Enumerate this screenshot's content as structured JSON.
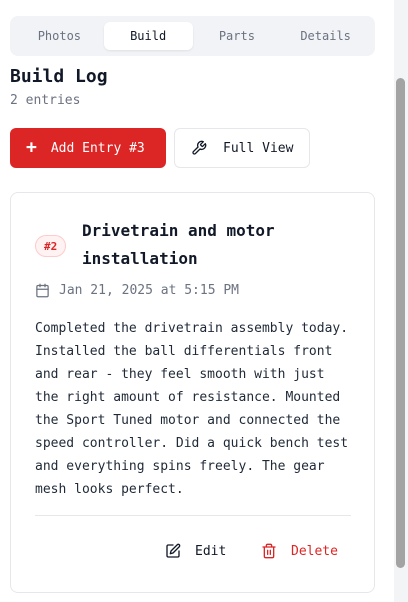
{
  "tabs": [
    {
      "label": "Photos",
      "active": false
    },
    {
      "label": "Build",
      "active": true
    },
    {
      "label": "Parts",
      "active": false
    },
    {
      "label": "Details",
      "active": false
    }
  ],
  "header": {
    "title": "Build Log",
    "subtitle": "2 entries"
  },
  "actions": {
    "add_label": "Add Entry #3",
    "full_view_label": "Full View"
  },
  "entry": {
    "badge": "#2",
    "title": "Drivetrain and motor installation",
    "date": "Jan 21, 2025 at 5:15 PM",
    "body": "Completed the drivetrain assembly today. Installed the ball differentials front and rear - they feel smooth with just the right amount of resistance. Mounted the Sport Tuned motor and connected the speed controller. Did a quick bench test and everything spins freely. The gear mesh looks perfect.",
    "edit_label": "Edit",
    "delete_label": "Delete"
  },
  "icons": {
    "add": "plus-icon",
    "full_view": "wrench-icon",
    "date": "calendar-icon",
    "edit": "edit-icon",
    "delete": "trash-icon"
  },
  "colors": {
    "accent": "#dc2626",
    "badge_bg": "#fef2f2",
    "muted_text": "#6b7280"
  }
}
